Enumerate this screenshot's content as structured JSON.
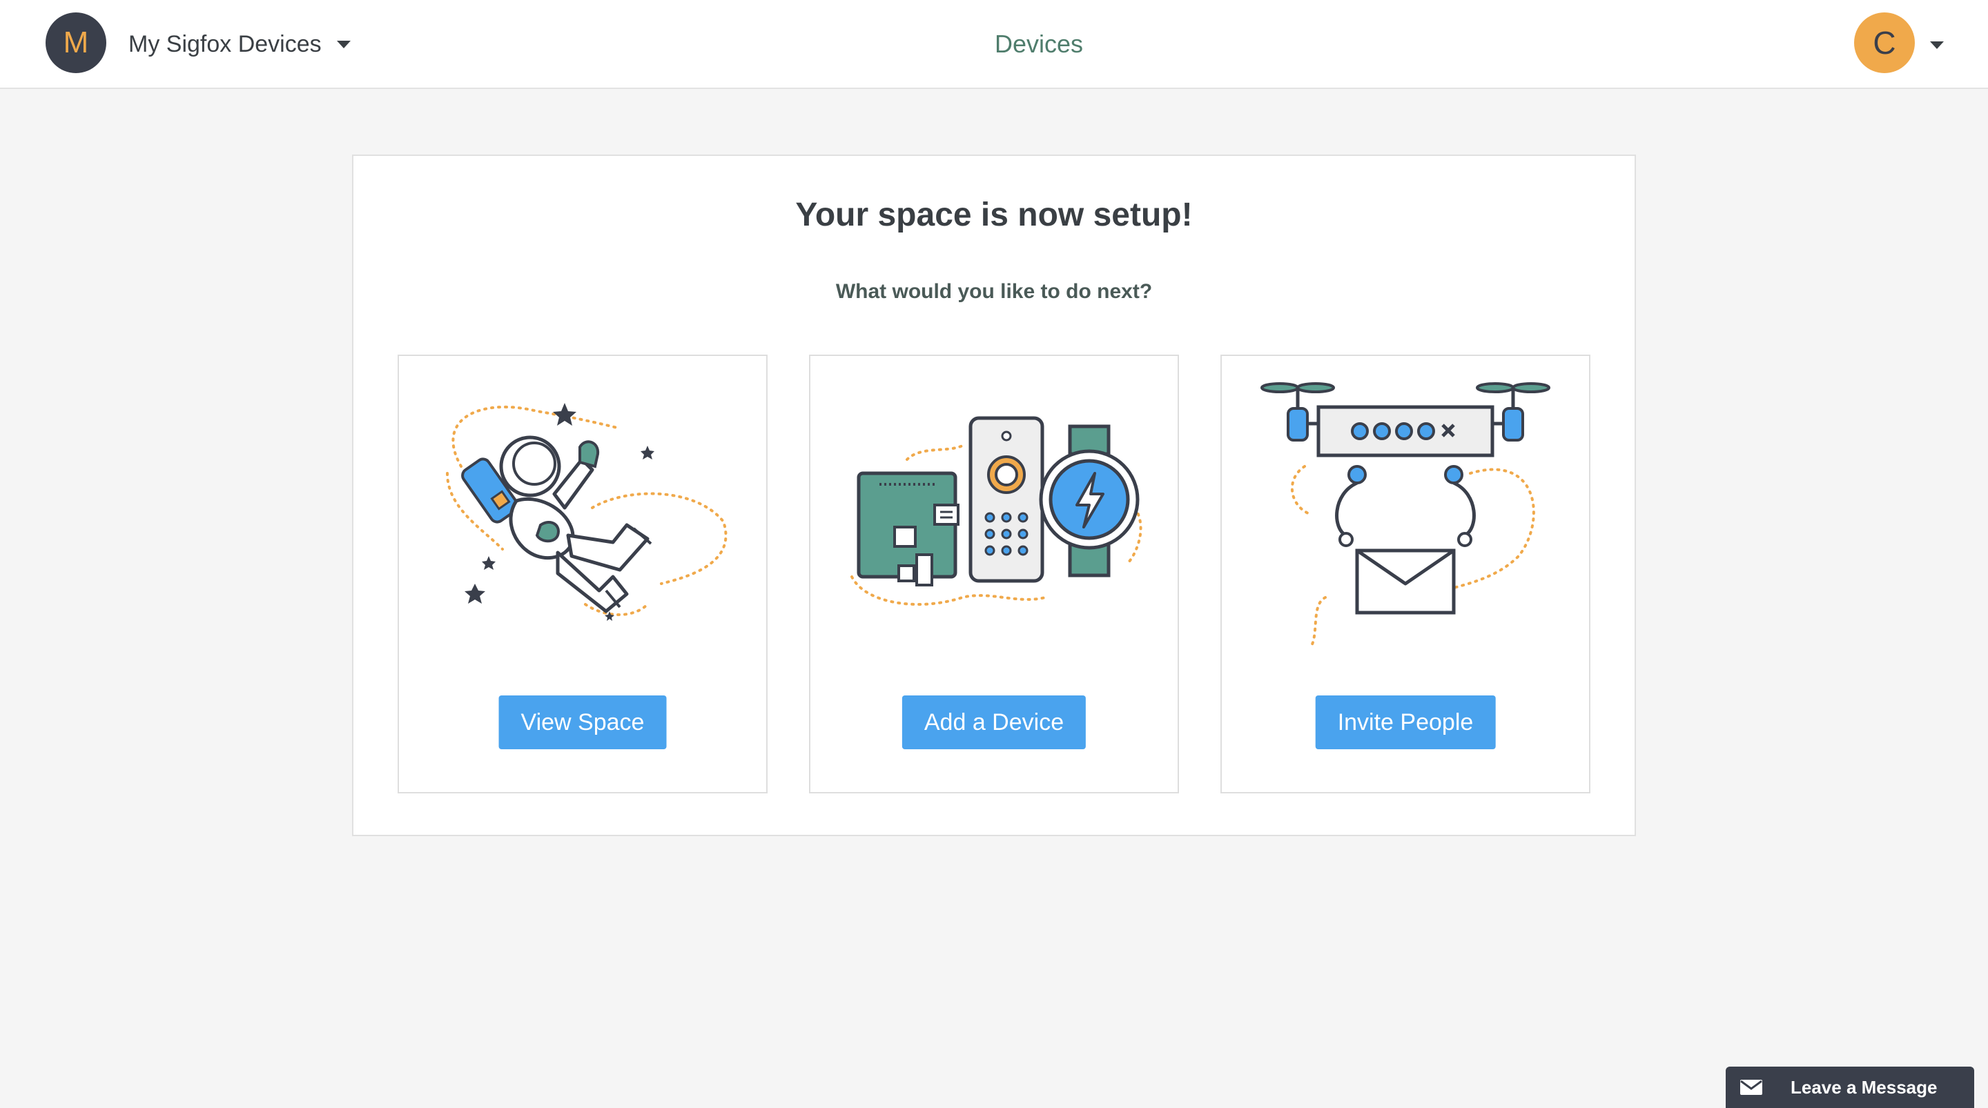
{
  "header": {
    "space_initial": "M",
    "space_name": "My Sigfox Devices",
    "nav_title": "Devices",
    "user_initial": "C"
  },
  "main": {
    "title": "Your space is now setup!",
    "subtitle": "What would you like to do next?",
    "options": [
      {
        "illustration": "astronaut-illustration",
        "button_label": "View Space"
      },
      {
        "illustration": "devices-illustration",
        "button_label": "Add a Device"
      },
      {
        "illustration": "drone-envelope-illustration",
        "button_label": "Invite People"
      }
    ]
  },
  "support": {
    "label": "Leave a Message",
    "icon": "envelope-icon"
  },
  "colors": {
    "accent_blue": "#4aa3ee",
    "dark": "#3a3f4b",
    "orange": "#f0a94b",
    "teal": "#5b9e8f",
    "nav_green": "#4f7d6c"
  }
}
